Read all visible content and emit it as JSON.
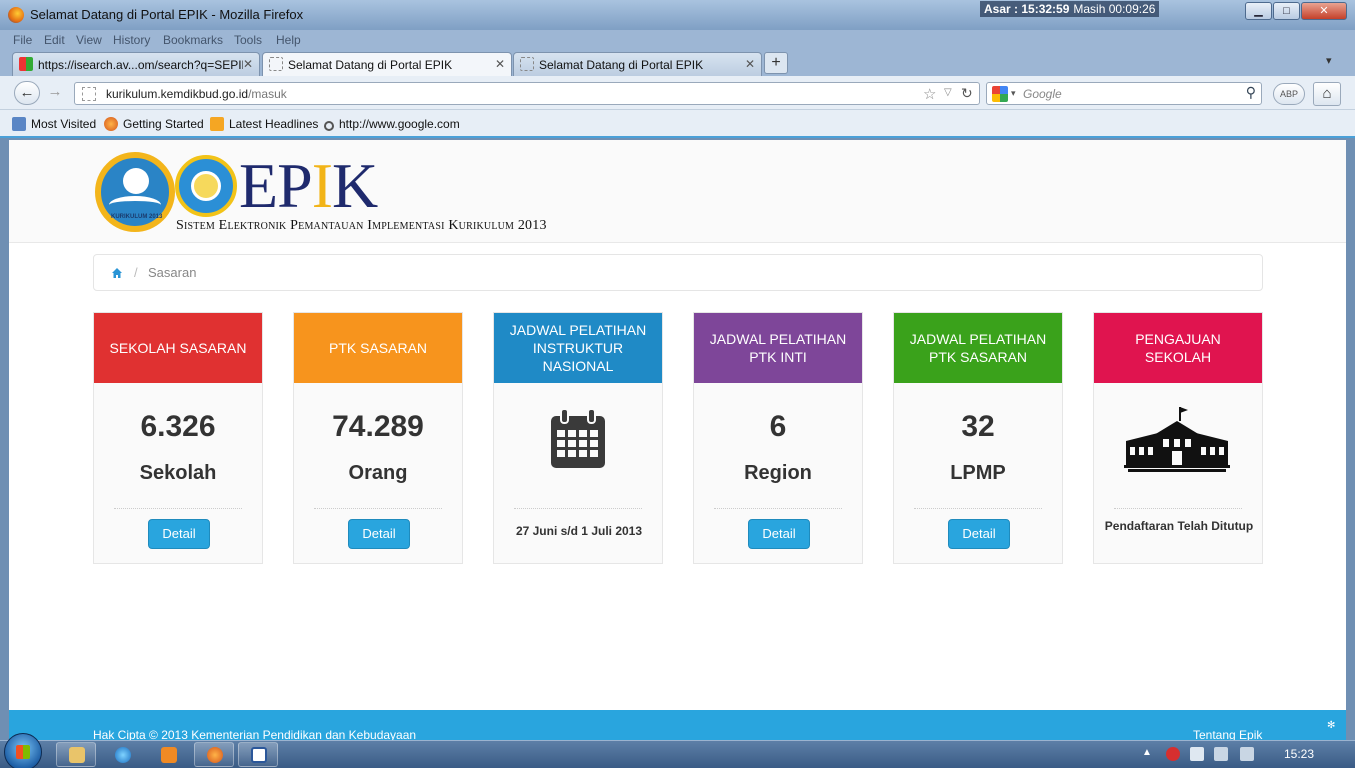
{
  "window": {
    "title": "Selamat Datang di Portal EPIK - Mozilla Firefox",
    "prayer_time": "Asar : 15:32:59",
    "remaining": "Masih 00:09:26",
    "min_label": "▁",
    "max_label": "□",
    "close_label": "✕"
  },
  "menu": [
    "File",
    "Edit",
    "View",
    "History",
    "Bookmarks",
    "Tools",
    "Help"
  ],
  "tabs": [
    {
      "label": "https://isearch.av...om/search?q=SEPIK",
      "close": "✕"
    },
    {
      "label": "Selamat Datang di Portal EPIK",
      "close": "✕"
    },
    {
      "label": "Selamat Datang di Portal EPIK",
      "close": "✕"
    }
  ],
  "new_tab": "+",
  "tab_list": "▾",
  "nav": {
    "back": "←",
    "forward": "→",
    "url_domain": "kurikulum.kemdikbud.go.id",
    "url_path": "/masuk",
    "star": "☆",
    "url_drop": "▽",
    "reload": "↻",
    "search_drop": "▾",
    "search_placeholder": "Google",
    "search_go": "⚲",
    "abp": "ABP",
    "home": "⌂"
  },
  "bookmarks": [
    "Most Visited",
    "Getting Started",
    "Latest Headlines",
    "http://www.google.com"
  ],
  "site": {
    "logo_word": "EP",
    "logo_i": "I",
    "logo_k": "K",
    "k13_ring": "KURIKULUM 2013",
    "subtitle": "Sistem Elektronik Pemantauan Implementasi Kurikulum 2013",
    "breadcrumb_sep": "/",
    "breadcrumb": "Sasaran",
    "footer_copy": "Hak Cipta © 2013 Kementerian Pendidikan dan Kebudayaan",
    "footer_about": "Tentang Epik",
    "footer_gear": "✻"
  },
  "cards": [
    {
      "title": "SEKOLAH SASARAN",
      "value": "6.326",
      "unit": "Sekolah",
      "button": "Detail",
      "color": "#e03131"
    },
    {
      "title": "PTK SASARAN",
      "value": "74.289",
      "unit": "Orang",
      "button": "Detail",
      "color": "#f7941d"
    },
    {
      "title": "JADWAL PELATIHAN INSTRUKTUR NASIONAL",
      "icon": "calendar-icon",
      "note": "27 Juni s/d 1 Juli 2013",
      "color": "#1f8ac6"
    },
    {
      "title": "JADWAL PELATIHAN PTK INTI",
      "value": "6",
      "unit": "Region",
      "button": "Detail",
      "color": "#7e4699"
    },
    {
      "title": "JADWAL PELATIHAN PTK SASARAN",
      "value": "32",
      "unit": "LPMP",
      "button": "Detail",
      "color": "#3aa21b"
    },
    {
      "title": "PENGAJUAN SEKOLAH",
      "icon": "school-building-icon",
      "note": "Pendaftaran Telah Ditutup",
      "color": "#e0144f"
    }
  ],
  "taskbar": {
    "clock": "15:23"
  }
}
